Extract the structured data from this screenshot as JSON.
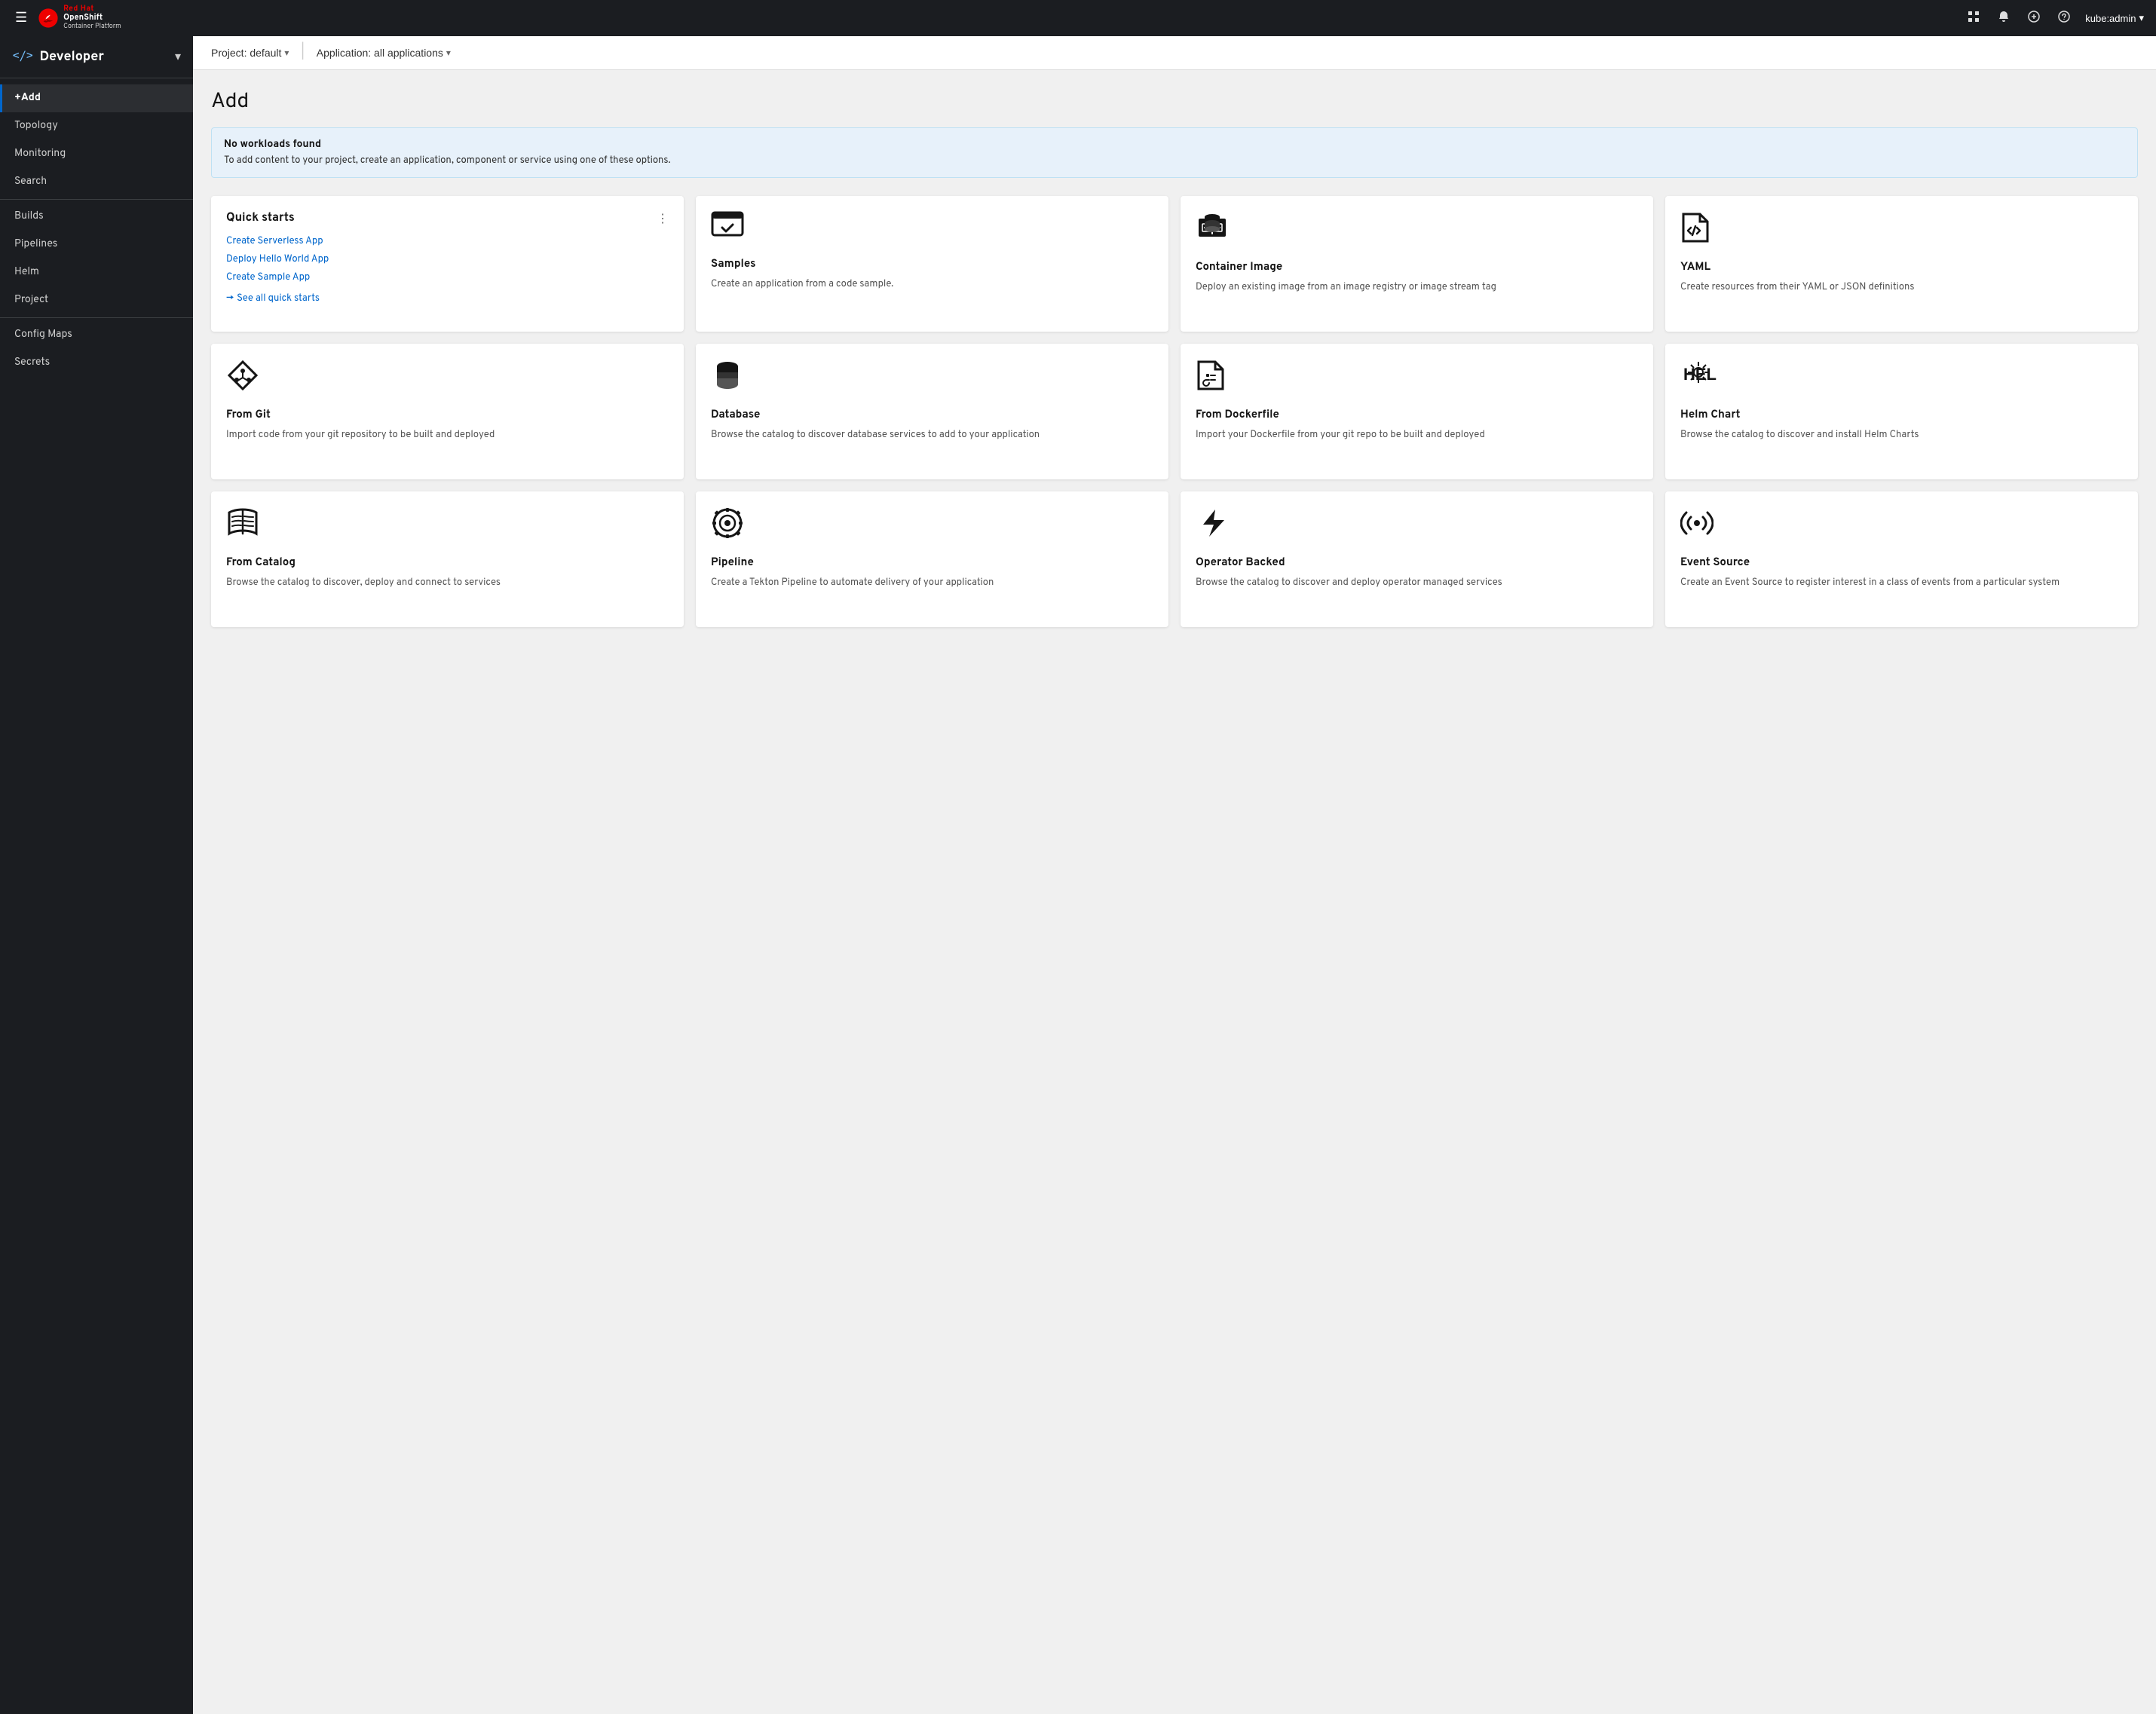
{
  "topNav": {
    "hamburger_label": "☰",
    "logo": {
      "line1": "Red Hat",
      "line2": "OpenShift",
      "line3": "Container Platform"
    },
    "icons": {
      "grid": "⊞",
      "bell": "🔔",
      "plus": "⊕",
      "help": "?"
    },
    "user": "kube:admin",
    "user_arrow": "▾"
  },
  "subHeader": {
    "project_label": "Project: default",
    "app_label": "Application: all applications",
    "arrow": "▾"
  },
  "sidebar": {
    "perspective_icon": "</>",
    "perspective_label": "Developer",
    "perspective_arrow": "▾",
    "items": [
      {
        "label": "+Add",
        "active": true
      },
      {
        "label": "Topology",
        "active": false
      },
      {
        "label": "Monitoring",
        "active": false
      },
      {
        "label": "Search",
        "active": false
      },
      {
        "label": "Builds",
        "active": false
      },
      {
        "label": "Pipelines",
        "active": false
      },
      {
        "label": "Helm",
        "active": false
      },
      {
        "label": "Project",
        "active": false
      },
      {
        "label": "Config Maps",
        "active": false
      },
      {
        "label": "Secrets",
        "active": false
      }
    ],
    "divider_after": [
      3,
      7
    ]
  },
  "page": {
    "title": "Add",
    "alert": {
      "title": "No workloads found",
      "body": "To add content to your project, create an application, component or service using one of these options."
    }
  },
  "quickStarts": {
    "title": "Quick starts",
    "menu_icon": "⋮",
    "links": [
      "Create Serverless App",
      "Deploy Hello World App",
      "Create Sample App"
    ],
    "see_all": "See all quick starts",
    "see_all_arrow": "→"
  },
  "cards": [
    {
      "id": "samples",
      "title": "Samples",
      "desc": "Create an application from a code sample.",
      "icon_type": "samples"
    },
    {
      "id": "container-image",
      "title": "Container Image",
      "desc": "Deploy an existing image from an image registry or image stream tag",
      "icon_type": "container"
    },
    {
      "id": "yaml",
      "title": "YAML",
      "desc": "Create resources from their YAML or JSON definitions",
      "icon_type": "yaml"
    },
    {
      "id": "from-git",
      "title": "From Git",
      "desc": "Import code from your git repository to be built and deployed",
      "icon_type": "git"
    },
    {
      "id": "database",
      "title": "Database",
      "desc": "Browse the catalog to discover database services to add to your application",
      "icon_type": "database"
    },
    {
      "id": "from-dockerfile",
      "title": "From Dockerfile",
      "desc": "Import your Dockerfile from your git repo to be built and deployed",
      "icon_type": "dockerfile"
    },
    {
      "id": "helm-chart",
      "title": "Helm Chart",
      "desc": "Browse the catalog to discover and install Helm Charts",
      "icon_type": "helm"
    },
    {
      "id": "from-catalog",
      "title": "From Catalog",
      "desc": "Browse the catalog to discover, deploy and connect to services",
      "icon_type": "catalog"
    },
    {
      "id": "pipeline",
      "title": "Pipeline",
      "desc": "Create a Tekton Pipeline to automate delivery of your application",
      "icon_type": "pipeline"
    },
    {
      "id": "operator-backed",
      "title": "Operator Backed",
      "desc": "Browse the catalog to discover and deploy operator managed services",
      "icon_type": "operator"
    },
    {
      "id": "event-source",
      "title": "Event Source",
      "desc": "Create an Event Source to register interest in a class of events from a particular system",
      "icon_type": "eventsource"
    }
  ]
}
